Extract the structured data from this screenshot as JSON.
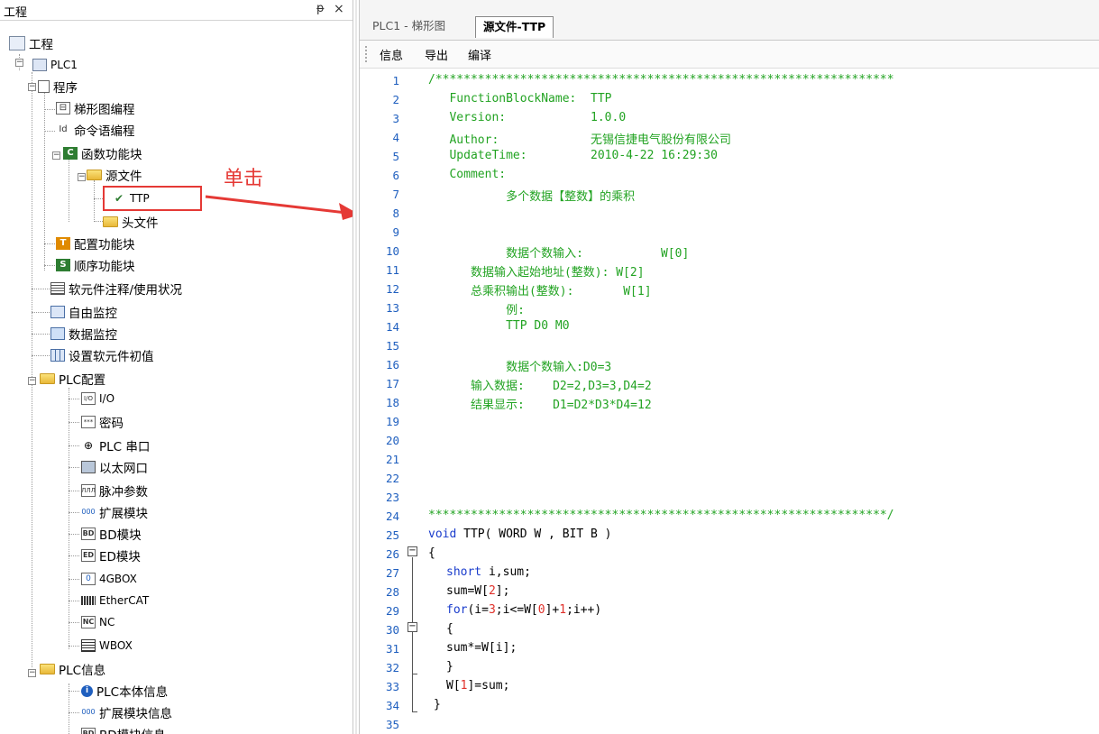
{
  "left_panel": {
    "title": "工程",
    "pin_glyph": "ᵽ",
    "close_glyph": "×",
    "tree": {
      "project": "工程",
      "plc1": "PLC1",
      "program": "程序",
      "ladder_programming": "梯形图编程",
      "command_programming": "命令语编程",
      "function_blocks": "函数功能块",
      "source_files": "源文件",
      "ttp": "TTP",
      "header_files": "头文件",
      "config_blocks": "配置功能块",
      "sequence_blocks": "顺序功能块",
      "soft_element_notes": "软元件注释/使用状况",
      "free_monitor": "自由监控",
      "data_monitor": "数据监控",
      "soft_element_init": "设置软元件初值",
      "plc_config": "PLC配置",
      "io": "I/O",
      "password": "密码",
      "plc_serial": "PLC 串口",
      "ethernet": "以太网口",
      "pulse_params": "脉冲参数",
      "expansion_module": "扩展模块",
      "bd_module": "BD模块",
      "ed_module": "ED模块",
      "gbox": "4GBOX",
      "ethercat": "EtherCAT",
      "nc": "NC",
      "wbox": "WBOX",
      "plc_info": "PLC信息",
      "plc_body_info": "PLC本体信息",
      "expansion_module_info": "扩展模块信息",
      "bd_module_info": "BD模块信息"
    },
    "icon_text": {
      "command": "Id",
      "function_badge": "C",
      "config_badge": "T",
      "sequence_badge": "S",
      "io": "I/O",
      "pulse": "ЛЛЛ",
      "expansion": "000",
      "bd": "BD",
      "ed": "ED",
      "gbox": "0",
      "nc": "NC"
    }
  },
  "annotation": {
    "text": "单击",
    "color": "#e53935"
  },
  "tabs": [
    {
      "label": "PLC1 - 梯形图"
    },
    {
      "label": "源文件-TTP"
    }
  ],
  "toolbar": {
    "info": "信息",
    "export": "导出",
    "compile": "编译"
  },
  "editor": {
    "line_numbers": [
      "1",
      "2",
      "3",
      "4",
      "5",
      "6",
      "7",
      "8",
      "9",
      "10",
      "11",
      "12",
      "13",
      "14",
      "15",
      "16",
      "17",
      "18",
      "19",
      "20",
      "21",
      "22",
      "23",
      "24",
      "25",
      "26",
      "27",
      "28",
      "29",
      "30",
      "31",
      "32",
      "33",
      "34",
      "35"
    ],
    "l1": "/*****************************************************************",
    "l2": "   FunctionBlockName:  TTP",
    "l3": "   Version:            1.0.0",
    "l4": "   Author:             无锡信捷电气股份有限公司",
    "l5": "   UpdateTime:         2010-4-22 16:29:30",
    "l6": "   Comment:",
    "l7": "           多个数据【整数】的乘积",
    "l10": "           数据个数输入:           W[0]",
    "l11": "      数据输入起始地址(整数): W[2]",
    "l12": "      总乘积输出(整数):       W[1]",
    "l13": "           例:",
    "l14": "           TTP D0 M0",
    "l16": "           数据个数输入:D0=3",
    "l17": "      输入数据:    D2=2,D3=3,D4=2",
    "l18": "      结果显示:    D1=D2*D3*D4=12",
    "l24": "*****************************************************************/",
    "l25_kw": "void",
    "l25_rest": " TTP( WORD W , BIT B )",
    "l26": "{",
    "l27_kw": "short",
    "l27_rest": " i,sum;",
    "l28_a": "sum=W[",
    "l28_n": "2",
    "l28_b": "];",
    "l29_kw": "for",
    "l29_a": "(i=",
    "l29_n1": "3",
    "l29_b": ";i<=W[",
    "l29_n2": "0",
    "l29_c": "]+",
    "l29_n3": "1",
    "l29_d": ";i++)",
    "l30": "{",
    "l31": "sum*=W[i];",
    "l32": "}",
    "l33_a": "W[",
    "l33_n": "1",
    "l33_b": "]=sum;",
    "l34": "}"
  },
  "colors": {
    "comment": "#22a322",
    "keyword": "#1a3ccc",
    "number": "#e0302a",
    "line_number": "#1f5fbf"
  }
}
